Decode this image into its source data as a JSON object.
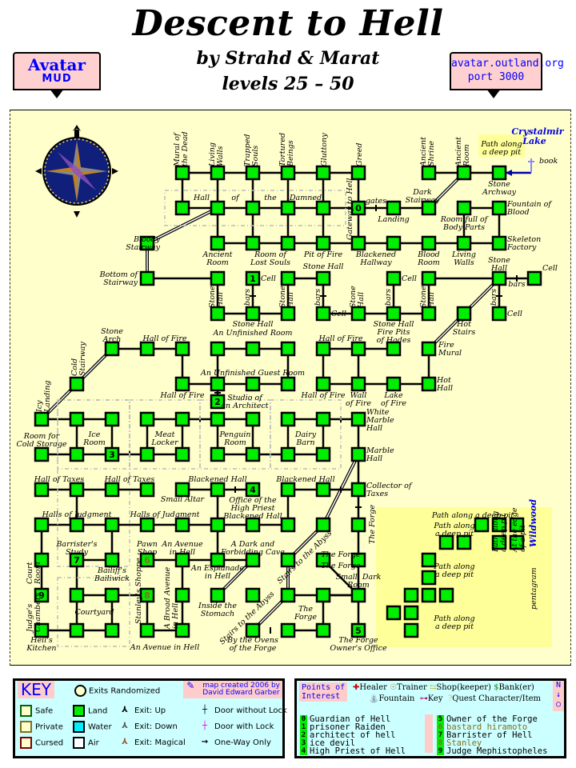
{
  "header": {
    "title": "Descent to Hell",
    "byline": "by Strahd & Marat",
    "levels": "levels 25 – 50",
    "left_banner": {
      "line1": "Avatar",
      "line2": "MUD"
    },
    "right_banner": {
      "line1": "avatar.outland.org",
      "line2": "port 3000"
    }
  },
  "colors": {
    "parchment": "#ffffcc",
    "land_room": "#00ee00",
    "banner": "#ffd0d0",
    "key_bg": "#ccffff",
    "link_blue": "#0000ff",
    "olive_text": "#807020"
  },
  "map": {
    "zones": {
      "crystalmir_lake": "Crystalmir Lake",
      "wildwood": "Wildwood"
    },
    "annotations": {
      "book": "book",
      "pentagram": "pentagram",
      "gates": "gates",
      "bars": "bars",
      "gateway": "Gateway to Hell"
    },
    "room_labels": {
      "mural_dead": "Mural of the Dead",
      "living_walls_top": "Living Walls",
      "trapped_souls": "Trapped Souls",
      "tortured_beings": "Tortured Beings",
      "gluttony": "Gluttony",
      "greed": "Greed",
      "ancient_shrine": "Ancient Shrine",
      "ancient_room_top": "Ancient Room",
      "path_pit_top": "Path along a deep pit",
      "stone_archway": "Stone Archway",
      "dark_stairway": "Dark Stairway",
      "landing": "Landing",
      "hall_of_damned": [
        "Hall",
        "of",
        "the",
        "Damned"
      ],
      "room_body_parts": "Room full of Body Parts",
      "fountain_blood": "Fountain of Blood",
      "bloody_stairway": "Bloody Stairway",
      "ancient_room": "Ancient Room",
      "room_lost_souls": "Room of Lost Souls",
      "pit_of_fire": "Pit of Fire",
      "blackened_hallway": "Blackened Hallway",
      "blood_room": "Blood Room",
      "living_walls": "Living Walls",
      "skeleton_factory": "Skeleton Factory",
      "bottom_stairway": "Bottom of Stairway",
      "stone_hall": "Stone Hall",
      "cell": "Cell",
      "hot_stairs": "Hot Stairs",
      "fire_mural": "Fire Mural",
      "stone_arch": "Stone Arch",
      "hall_of_fire": "Hall of Fire",
      "unfinished_room": "An Unfinished Room",
      "fire_pits_hades": "Fire Pits of Hades",
      "cold_stairway": "Cold Stairway",
      "unfinished_guest_room": "An Unfinished Guest Room",
      "hot_hall": "Hot Hall",
      "icy_landing": "Icy Landing",
      "studio_architect": "Studio of an Architect",
      "wall_of_fire": "Wall of Fire",
      "lake_of_fire": "Lake of Fire",
      "white_marble_hall": "White Marble Hall",
      "room_cold_storage": "Room for Cold Storage",
      "ice_room": "Ice Room",
      "meat_locker": "Meat Locker",
      "penguin_room": "Penguin Room",
      "dairy_barn": "Dairy Barn",
      "marble_hall": "Marble Hall",
      "hall_of_taxes": "Hall of Taxes",
      "blackened_hall": "Blackened Hall",
      "small_altar": "Small Altar",
      "office_high_priest": "Office of the High Priest",
      "collector_taxes": "Collector of Taxes",
      "halls_judgment": "Halls of Judgment",
      "the_forge": "The Forge",
      "barristers_study": "Barrister's Study",
      "pawn_shop": "Pawn Shop",
      "avenue_hell": "An Avenue in Hell",
      "dark_cave": "A Dark and Forbidding Cave",
      "court_room": "Court Room",
      "bailiffs_bailiwick": "Bailiff's Bailiwick",
      "esplanade": "An Esplanade in Hell",
      "stairs_abyss": "Stairs to the Abyss",
      "small_dark_room": "Small, Dark Room",
      "judges_chambers": "Judge's Chambers",
      "courtyard": "Courtyard",
      "stanleys_shoppe": "Stanley's Shoppe",
      "broad_avenue": "A Broad Avenue in Hell",
      "inside_stomach": "Inside the Stomach",
      "hells_kitchen": "Hell's Kitchen",
      "by_ovens": "By the Ovens of the Forge",
      "forge_owner_office": "The Forge Owner's Office",
      "path_pit": "Path along a deep pit",
      "edge_of_pit": "At the edge of a pit"
    }
  },
  "key": {
    "title": "KEY",
    "exits_randomized": "Exits Randomized",
    "credit_line1": "map created 2006 by",
    "credit_line2": "David Edward Garber",
    "room_types": [
      {
        "label": "Safe",
        "border": "#006600",
        "fill": "#ffffcc"
      },
      {
        "label": "Private",
        "border": "#807020",
        "fill": "#ffffcc"
      },
      {
        "label": "Cursed",
        "border": "#800000",
        "fill": "#ffffcc"
      }
    ],
    "terrain": [
      {
        "label": "Land",
        "fill": "#00ee00"
      },
      {
        "label": "Water",
        "fill": "#00eeff"
      },
      {
        "label": "Air",
        "fill": "#ffffff"
      }
    ],
    "exits": [
      {
        "label": "Exit: Up"
      },
      {
        "label": "Exit: Down"
      },
      {
        "label": "Exit: Magical"
      }
    ],
    "doors": [
      {
        "label": "Door without Lock"
      },
      {
        "label": "Door with Lock"
      },
      {
        "label": "One-Way Only"
      }
    ]
  },
  "poi": {
    "title_line1": "Points of",
    "title_line2": "Interest",
    "legend": [
      "Healer",
      "Trainer",
      "Shop(keeper)",
      "Bank(er)",
      "Fountain",
      "Key",
      "Quest Character/Item"
    ],
    "compass": "N",
    "items": [
      {
        "num": "0",
        "name": "Guardian of Hell",
        "olive": false
      },
      {
        "num": "1",
        "name": "prisoner Raiden",
        "olive": false
      },
      {
        "num": "2",
        "name": "architect of hell",
        "olive": false
      },
      {
        "num": "3",
        "name": "ice devil",
        "olive": false
      },
      {
        "num": "4",
        "name": "High Priest of Hell",
        "olive": false
      },
      {
        "num": "5",
        "name": "Owner of the Forge",
        "olive": false
      },
      {
        "num": "6",
        "name": "bastard hiramoto",
        "olive": true
      },
      {
        "num": "7",
        "name": "Barrister of Hell",
        "olive": false
      },
      {
        "num": "8",
        "name": "Stanley",
        "olive": true
      },
      {
        "num": "9",
        "name": "Judge Mephistopheles",
        "olive": false
      }
    ]
  }
}
